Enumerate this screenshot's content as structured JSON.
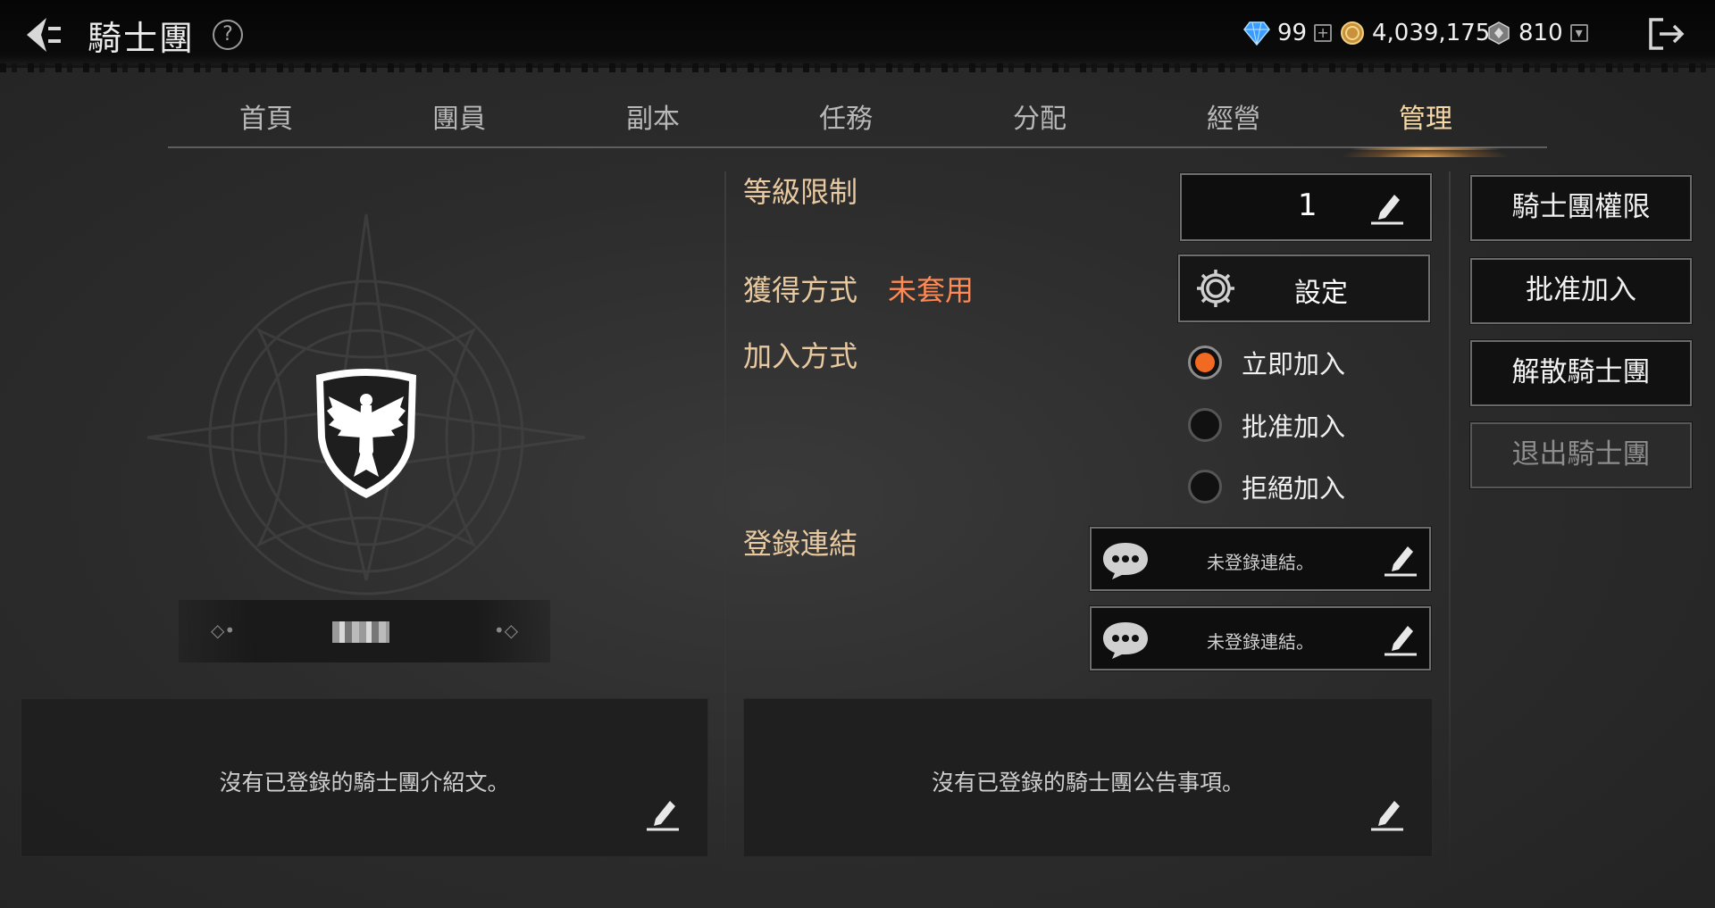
{
  "header": {
    "title": "騎士團",
    "help_symbol": "?",
    "currencies": [
      {
        "icon": "diamond-icon",
        "value": "99",
        "color": "#4aa8ff"
      },
      {
        "icon": "gold-coin-icon",
        "value": "4,039,175",
        "color": "#d9a441"
      },
      {
        "icon": "silver-token-icon",
        "value": "810",
        "color": "#bbbbbb"
      }
    ],
    "add_symbol": "+",
    "dropdown_symbol": "▾"
  },
  "tabs": [
    {
      "label": "首頁"
    },
    {
      "label": "團員"
    },
    {
      "label": "副本"
    },
    {
      "label": "任務"
    },
    {
      "label": "分配"
    },
    {
      "label": "經營"
    },
    {
      "label": "管理"
    }
  ],
  "active_tab": "管理",
  "emblem": {
    "icon": "eagle-shield-icon",
    "deco_left": "◇•",
    "deco_right": "•◇"
  },
  "intro": {
    "text": "沒有已登錄的騎士團介紹文。"
  },
  "notice": {
    "text": "沒有已登錄的騎士團公告事項。"
  },
  "settings": {
    "level_label": "等級限制",
    "level_value": "1",
    "acquire_label": "獲得方式",
    "acquire_status": "未套用",
    "setting_button": "設定",
    "join_label": "加入方式",
    "join_options": [
      {
        "label": "立即加入",
        "selected": true
      },
      {
        "label": "批准加入",
        "selected": false
      },
      {
        "label": "拒絕加入",
        "selected": false
      }
    ],
    "link_label": "登錄連結",
    "links": [
      {
        "text": "未登錄連結。"
      },
      {
        "text": "未登錄連結。"
      }
    ]
  },
  "actions": [
    {
      "label": "騎士團權限",
      "enabled": true
    },
    {
      "label": "批准加入",
      "enabled": true
    },
    {
      "label": "解散騎士團",
      "enabled": true
    },
    {
      "label": "退出騎士團",
      "enabled": false
    }
  ],
  "colors": {
    "accent_orange": "#f26a21",
    "label_gold": "#e8c9a0",
    "status_red": "#ff8a55"
  }
}
